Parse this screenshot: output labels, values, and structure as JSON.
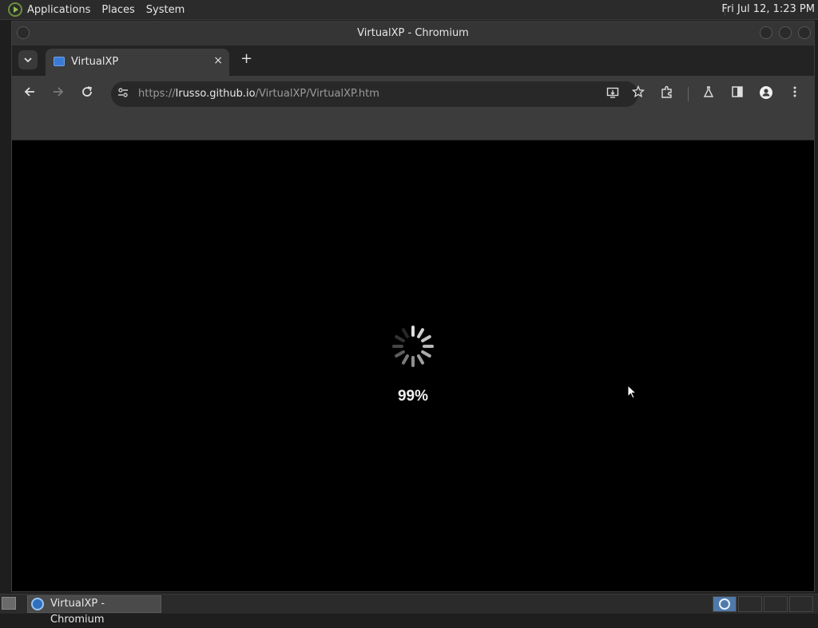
{
  "top_panel": {
    "menus": [
      "Applications",
      "Places",
      "System"
    ],
    "clock": "Fri Jul 12,  1:23 PM"
  },
  "window": {
    "title": "VirtualXP - Chromium"
  },
  "tab": {
    "title": "VirtualXP",
    "close_icon": "×",
    "new_tab_icon": "+"
  },
  "toolbar": {
    "url_scheme": "https://",
    "url_host": "lrusso.github.io",
    "url_path": "/VirtualXP/VirtualXP.htm"
  },
  "content": {
    "progress_text": "99%",
    "progress_fraction": 0.99
  },
  "taskbar": {
    "tasks": [
      "VirtualXP - Chromium"
    ]
  },
  "icons": {
    "menu": "panel-menu-logo",
    "back": "arrow-left-icon",
    "forward": "arrow-right-icon",
    "reload": "reload-icon",
    "site_info": "tune-icon",
    "install": "install-app-icon",
    "bookmark": "star-icon",
    "extensions": "puzzle-icon",
    "labs": "flask-icon",
    "side_panel": "side-panel-icon",
    "profile": "profile-icon",
    "more": "kebab-menu-icon",
    "spinner": "loading-spinner-icon"
  },
  "colors": {
    "panel_bg": "#2b2b2b",
    "toolbar_bg": "#3c3c3c",
    "content_bg": "#000000",
    "workspace_active": "#4f79a8"
  }
}
